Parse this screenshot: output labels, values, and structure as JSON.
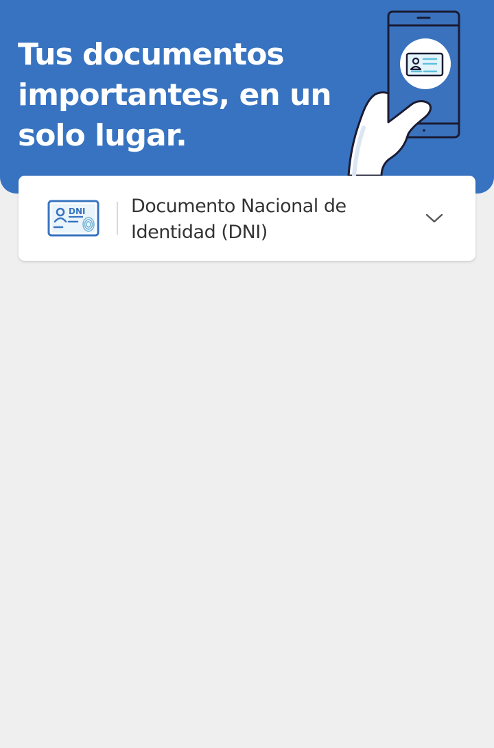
{
  "hero": {
    "title": "Tus documentos importantes, en un solo lugar.",
    "illustration": "hand-holding-phone-with-id-card",
    "background_color": "#3773c0"
  },
  "document_selector": {
    "icon": "dni-card-icon",
    "icon_text": "DNI",
    "label": "Documento Nacional de Identidad (DNI)",
    "expand_icon": "chevron-down-icon"
  },
  "colors": {
    "accent": "#3773c0",
    "page_background": "#efefef",
    "card_background": "#ffffff",
    "text_primary": "#333333"
  }
}
